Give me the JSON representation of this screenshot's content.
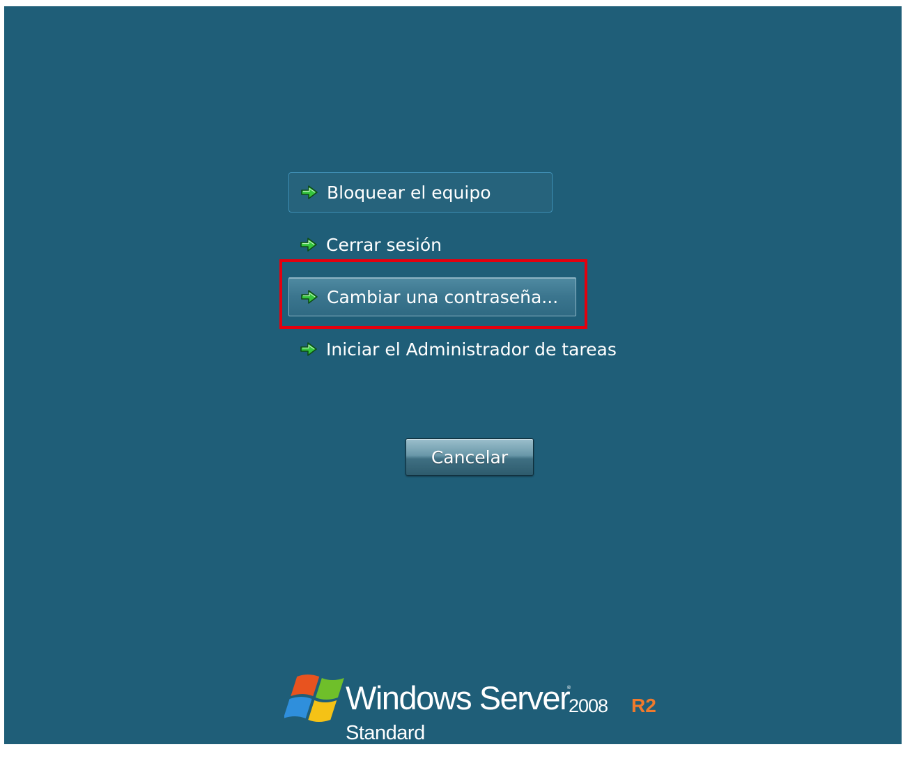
{
  "options": [
    {
      "label": "Bloquear el equipo",
      "icon": "green-arrow-icon"
    },
    {
      "label": "Cerrar sesión",
      "icon": "green-arrow-icon"
    },
    {
      "label": "Cambiar una contraseña...",
      "icon": "green-arrow-icon"
    },
    {
      "label": "Iniciar el Administrador de tareas",
      "icon": "green-arrow-icon"
    }
  ],
  "cancel_label": "Cancelar",
  "branding": {
    "product": "Windows Server",
    "version": "2008",
    "release": "R2",
    "edition": "Standard",
    "logo_icon": "windows-flag-icon"
  },
  "colors": {
    "background": "#1f5e78",
    "highlight_box": "#e4000e",
    "arrow": "#2fbf3a",
    "r2": "#f07a2c"
  }
}
